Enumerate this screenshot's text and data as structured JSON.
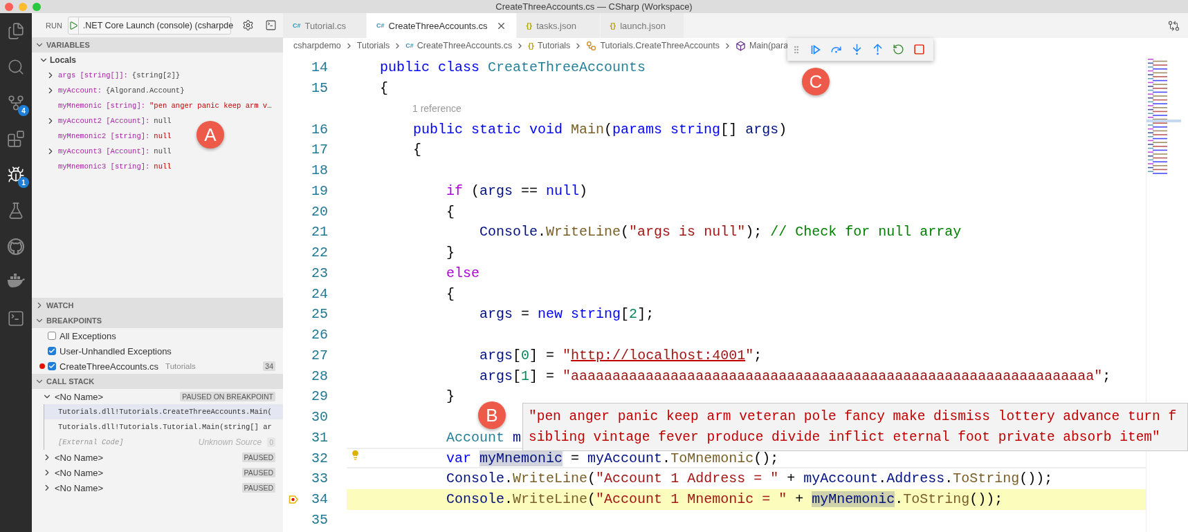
{
  "window": {
    "title": "CreateThreeAccounts.cs — CSharp (Workspace)"
  },
  "activity_bar": [
    {
      "kind": "explorer",
      "selected": false
    },
    {
      "kind": "search",
      "selected": false
    },
    {
      "kind": "source-control",
      "badge": "4",
      "selected": false
    },
    {
      "kind": "extensions",
      "selected": false
    },
    {
      "kind": "debug",
      "badge": "1",
      "selected": true
    },
    {
      "kind": "testing",
      "selected": false
    },
    {
      "kind": "github",
      "selected": false
    },
    {
      "kind": "docker",
      "selected": false
    },
    {
      "kind": "powershell",
      "selected": false
    }
  ],
  "run_toolbar": {
    "label": "RUN",
    "configuration": ".NET Core Launch (console) (csharpde"
  },
  "variables": {
    "title": "VARIABLES",
    "expanded": true,
    "scope": {
      "label": "Locals",
      "expanded": true
    },
    "items": [
      {
        "name": "args [string[]]:",
        "value": "{string[2]}",
        "kind": "object",
        "expandable": true
      },
      {
        "name": "myAccount:",
        "value": "{Algorand.Account}",
        "kind": "object",
        "expandable": true
      },
      {
        "name": "myMnemonic [string]:",
        "value": "\"pen anger panic keep arm v…",
        "kind": "string",
        "expandable": false
      },
      {
        "name": "myAccount2 [Account]:",
        "value": "null",
        "kind": "object",
        "expandable": true
      },
      {
        "name": "myMnemonic2 [string]:",
        "value": "null",
        "kind": "string",
        "expandable": false
      },
      {
        "name": "myAccount3 [Account]:",
        "value": "null",
        "kind": "object",
        "expandable": true
      },
      {
        "name": "myMnemonic3 [string]:",
        "value": "null",
        "kind": "string",
        "expandable": false
      }
    ]
  },
  "watch": {
    "title": "WATCH",
    "expanded": false
  },
  "breakpoints": {
    "title": "BREAKPOINTS",
    "expanded": true,
    "items": [
      {
        "kind": "exception",
        "label": "All Exceptions",
        "checked": false
      },
      {
        "kind": "exception",
        "label": "User-Unhandled Exceptions",
        "checked": true
      },
      {
        "kind": "source",
        "label": "CreateThreeAccounts.cs",
        "description": "Tutorials",
        "line": "34",
        "checked": true
      }
    ]
  },
  "call_stack": {
    "title": "CALL STACK",
    "expanded": true,
    "threads": [
      {
        "name": "<No Name>",
        "status": "PAUSED ON BREAKPOINT",
        "expanded": true,
        "frames": [
          {
            "kind": "frame",
            "label": "Tutorials.dll!Tutorials.CreateThreeAccounts.Main(",
            "selected": true
          },
          {
            "kind": "frame",
            "label": "Tutorials.dll!Tutorials.Tutorial.Main(string[] ar",
            "selected": false
          },
          {
            "kind": "external",
            "label": "[External Code]",
            "source": "Unknown Source",
            "line": "0",
            "selected": false
          }
        ]
      },
      {
        "name": "<No Name>",
        "status": "PAUSED",
        "expanded": false
      },
      {
        "name": "<No Name>",
        "status": "PAUSED",
        "expanded": false
      },
      {
        "name": "<No Name>",
        "status": "PAUSED",
        "expanded": false
      }
    ]
  },
  "tabs": [
    {
      "kind": "csharp",
      "glyph": "C#",
      "label": "Tutorial.cs",
      "selected": false
    },
    {
      "kind": "csharp",
      "glyph": "C#",
      "label": "CreateThreeAccounts.cs",
      "selected": true
    },
    {
      "kind": "json",
      "glyph": "{}",
      "label": "tasks.json",
      "selected": false
    },
    {
      "kind": "json",
      "glyph": "{}",
      "label": "launch.json",
      "selected": false
    }
  ],
  "breadcrumb": [
    {
      "kind": "folder",
      "label": "csharpdemo"
    },
    {
      "kind": "folder",
      "label": "Tutorials"
    },
    {
      "kind": "csharp",
      "glyph": "C#",
      "label": "CreateThreeAccounts.cs"
    },
    {
      "kind": "namespace",
      "glyph": "{}",
      "label": "Tutorials"
    },
    {
      "kind": "class",
      "label": "Tutorials.CreateThreeAccounts"
    },
    {
      "kind": "method",
      "label": "Main(para"
    }
  ],
  "debug_toolbar": [
    {
      "kind": "grip"
    },
    {
      "kind": "continue"
    },
    {
      "kind": "step-over"
    },
    {
      "kind": "step-into"
    },
    {
      "kind": "step-out"
    },
    {
      "kind": "restart"
    },
    {
      "kind": "stop"
    }
  ],
  "editor": {
    "lines": [
      {
        "kind": "code",
        "number": "14",
        "tokens": [
          {
            "text": "    public class ",
            "kind": "kw"
          },
          {
            "text": "CreateThreeAccounts",
            "kind": "type"
          }
        ]
      },
      {
        "kind": "code",
        "number": "15",
        "tokens": [
          {
            "text": "    {",
            "kind": "plain"
          }
        ]
      },
      {
        "kind": "codelens",
        "text": "1 reference"
      },
      {
        "kind": "code",
        "number": "16",
        "tokens": [
          {
            "text": "        public static void ",
            "kind": "kw"
          },
          {
            "text": "Main",
            "kind": "fn"
          },
          {
            "text": "(",
            "kind": "plain"
          },
          {
            "text": "params string",
            "kind": "kw"
          },
          {
            "text": "[] ",
            "kind": "plain"
          },
          {
            "text": "args",
            "kind": "var"
          },
          {
            "text": ")",
            "kind": "plain"
          }
        ]
      },
      {
        "kind": "code",
        "number": "17",
        "tokens": [
          {
            "text": "        {",
            "kind": "plain"
          }
        ]
      },
      {
        "kind": "code",
        "number": "18"
      },
      {
        "kind": "code",
        "number": "19",
        "tokens": [
          {
            "text": "            if",
            "kind": "ctl"
          },
          {
            "text": " (",
            "kind": "plain"
          },
          {
            "text": "args",
            "kind": "var"
          },
          {
            "text": " == ",
            "kind": "plain"
          },
          {
            "text": "null",
            "kind": "kw"
          },
          {
            "text": ")",
            "kind": "plain"
          }
        ]
      },
      {
        "kind": "code",
        "number": "20",
        "tokens": [
          {
            "text": "            {",
            "kind": "plain"
          }
        ]
      },
      {
        "kind": "code",
        "number": "21",
        "tokens": [
          {
            "text": "                Console",
            "kind": "var"
          },
          {
            "text": ".",
            "kind": "plain"
          },
          {
            "text": "WriteLine",
            "kind": "fn"
          },
          {
            "text": "(",
            "kind": "plain"
          },
          {
            "text": "\"args is null\"",
            "kind": "str"
          },
          {
            "text": "); ",
            "kind": "plain"
          },
          {
            "text": "// Check for null array",
            "kind": "cmt"
          }
        ]
      },
      {
        "kind": "code",
        "number": "22",
        "tokens": [
          {
            "text": "            }",
            "kind": "plain"
          }
        ]
      },
      {
        "kind": "code",
        "number": "23",
        "tokens": [
          {
            "text": "            else",
            "kind": "ctl"
          }
        ]
      },
      {
        "kind": "code",
        "number": "24",
        "tokens": [
          {
            "text": "            {",
            "kind": "plain"
          }
        ]
      },
      {
        "kind": "code",
        "number": "25",
        "tokens": [
          {
            "text": "                args",
            "kind": "var"
          },
          {
            "text": " = ",
            "kind": "plain"
          },
          {
            "text": "new string",
            "kind": "kw"
          },
          {
            "text": "[",
            "kind": "plain"
          },
          {
            "text": "2",
            "kind": "num"
          },
          {
            "text": "];",
            "kind": "plain"
          }
        ]
      },
      {
        "kind": "code",
        "number": "26"
      },
      {
        "kind": "code",
        "number": "27",
        "tokens": [
          {
            "text": "                args",
            "kind": "var"
          },
          {
            "text": "[",
            "kind": "plain"
          },
          {
            "text": "0",
            "kind": "num"
          },
          {
            "text": "] = ",
            "kind": "plain"
          },
          {
            "text": "\"",
            "kind": "str"
          },
          {
            "text": "http://localhost:4001",
            "kind": "link"
          },
          {
            "text": "\"",
            "kind": "str"
          },
          {
            "text": ";",
            "kind": "plain"
          }
        ]
      },
      {
        "kind": "code",
        "number": "28",
        "tokens": [
          {
            "text": "                args",
            "kind": "var"
          },
          {
            "text": "[",
            "kind": "plain"
          },
          {
            "text": "1",
            "kind": "num"
          },
          {
            "text": "] = ",
            "kind": "plain"
          },
          {
            "text": "\"aaaaaaaaaaaaaaaaaaaaaaaaaaaaaaaaaaaaaaaaaaaaaaaaaaaaaaaaaaaaaaa\"",
            "kind": "str"
          },
          {
            "text": ";",
            "kind": "plain"
          }
        ]
      },
      {
        "kind": "code",
        "number": "29",
        "tokens": [
          {
            "text": "            }",
            "kind": "plain"
          }
        ]
      },
      {
        "kind": "code",
        "number": "30"
      },
      {
        "kind": "code",
        "number": "31",
        "tokens": [
          {
            "text": "            Account",
            "kind": "type"
          },
          {
            "text": " m",
            "kind": "var"
          }
        ]
      },
      {
        "kind": "current",
        "number": "32",
        "tokens": [
          {
            "text": "            var ",
            "kind": "kw"
          },
          {
            "text": "myMnemonic",
            "kind": "hl"
          },
          {
            "text": " = ",
            "kind": "plain"
          },
          {
            "text": "myAccount",
            "kind": "var"
          },
          {
            "text": ".",
            "kind": "plain"
          },
          {
            "text": "ToMnemonic",
            "kind": "fn"
          },
          {
            "text": "();",
            "kind": "plain"
          }
        ]
      },
      {
        "kind": "code",
        "number": "33",
        "tokens": [
          {
            "text": "            Console",
            "kind": "var"
          },
          {
            "text": ".",
            "kind": "plain"
          },
          {
            "text": "WriteLine",
            "kind": "fn"
          },
          {
            "text": "(",
            "kind": "plain"
          },
          {
            "text": "\"Account 1 Address = \"",
            "kind": "str"
          },
          {
            "text": " + ",
            "kind": "plain"
          },
          {
            "text": "myAccount",
            "kind": "var"
          },
          {
            "text": ".",
            "kind": "plain"
          },
          {
            "text": "Address",
            "kind": "var"
          },
          {
            "text": ".",
            "kind": "plain"
          },
          {
            "text": "ToString",
            "kind": "fn"
          },
          {
            "text": "());",
            "kind": "plain"
          }
        ]
      },
      {
        "kind": "paused",
        "number": "34",
        "tokens": [
          {
            "text": "            Console",
            "kind": "var"
          },
          {
            "text": ".",
            "kind": "plain"
          },
          {
            "text": "WriteLine",
            "kind": "fn"
          },
          {
            "text": "(",
            "kind": "plain"
          },
          {
            "text": "\"Account 1 Mnemonic = \"",
            "kind": "str"
          },
          {
            "text": " + ",
            "kind": "plain"
          },
          {
            "text": "myMnemonic",
            "kind": "hl"
          },
          {
            "text": ".",
            "kind": "plain"
          },
          {
            "text": "ToString",
            "kind": "fn"
          },
          {
            "text": "());",
            "kind": "plain"
          }
        ]
      },
      {
        "kind": "code",
        "number": "35"
      }
    ]
  },
  "hover": {
    "lines": [
      "\"pen anger panic keep arm veteran pole fancy make dismiss lottery advance turn f",
      "sibling vintage fever produce divide inflict eternal foot private absorb item\""
    ]
  },
  "callouts": [
    {
      "label": "A"
    },
    {
      "label": "B"
    },
    {
      "label": "C"
    }
  ]
}
